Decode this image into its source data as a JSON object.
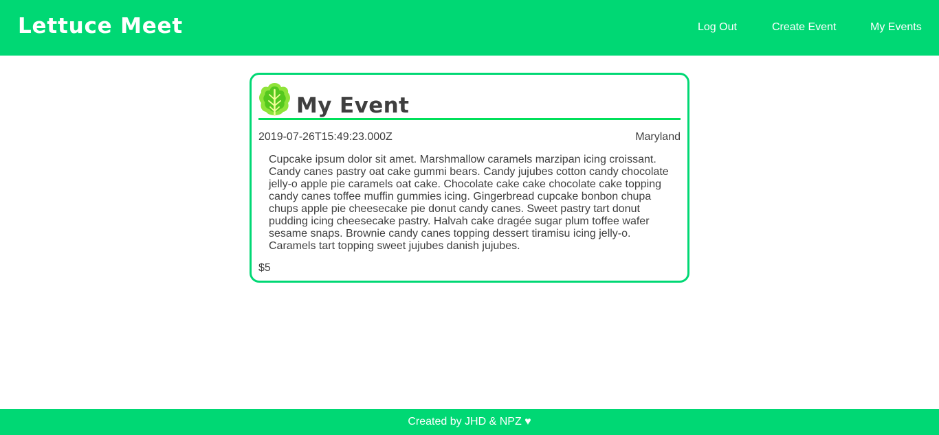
{
  "header": {
    "brand": "Lettuce Meet",
    "nav": {
      "log_out": "Log Out",
      "create_event": "Create Event",
      "my_events": "My Events"
    }
  },
  "event": {
    "icon": "lettuce-icon",
    "title": "My Event",
    "date": "2019-07-26T15:49:23.000Z",
    "location": "Maryland",
    "description": "Cupcake ipsum dolor sit amet. Marshmallow caramels marzipan icing croissant. Candy canes pastry oat cake gummi bears. Candy jujubes cotton candy chocolate jelly-o apple pie caramels oat cake. Chocolate cake cake chocolate cake topping candy canes toffee muffin gummies icing. Gingerbread cupcake bonbon chupa chups apple pie cheesecake pie donut candy canes. Sweet pastry tart donut pudding icing cheesecake pastry. Halvah cake dragée sugar plum toffee wafer sesame snaps. Brownie candy canes topping dessert tiramisu icing jelly-o. Caramels tart topping sweet jujubes danish jujubes.",
    "price": "$5"
  },
  "footer": {
    "text": "Created by JHD & NPZ ♥"
  },
  "colors": {
    "brand_green": "#00d874",
    "rule_green": "#00e05a",
    "text": "#3f3f3f"
  }
}
